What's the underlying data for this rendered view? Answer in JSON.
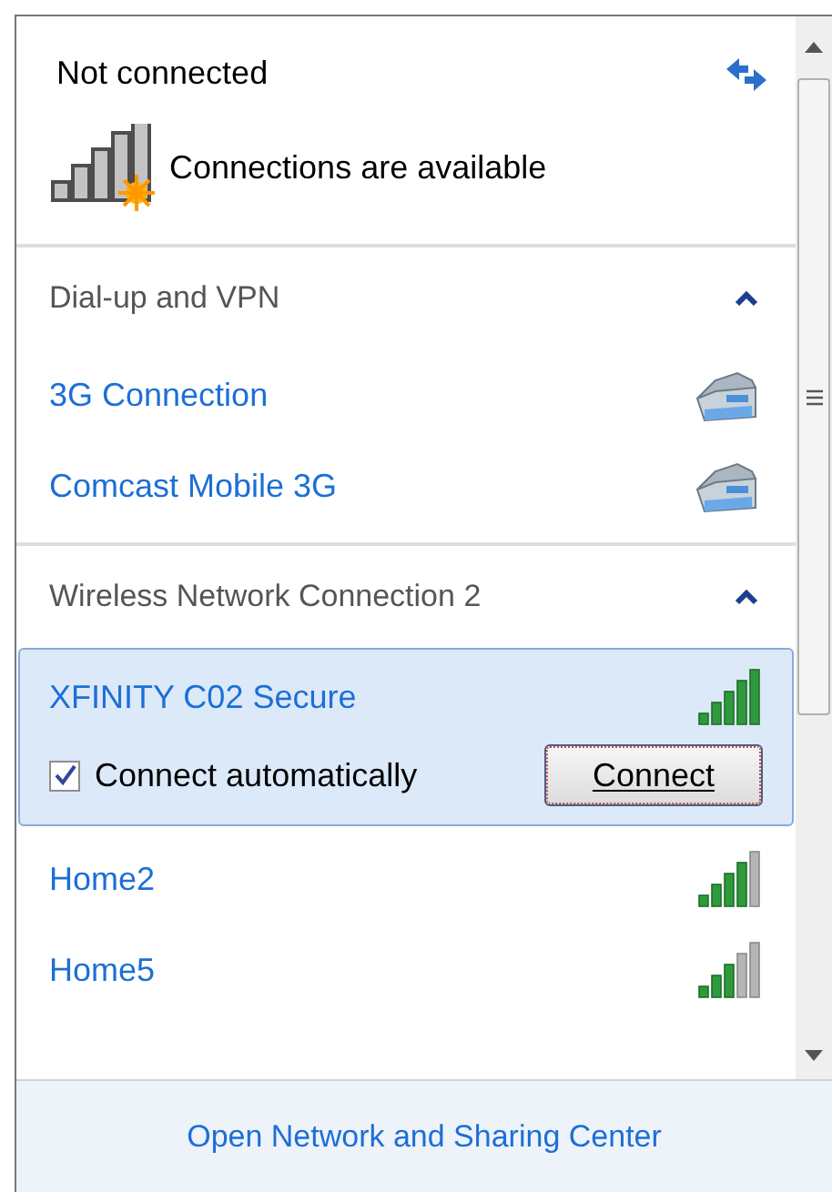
{
  "header": {
    "title": "Not connected",
    "status": "Connections are available"
  },
  "sections": [
    {
      "title": "Dial-up and VPN",
      "expanded": true,
      "items": [
        {
          "kind": "dialup",
          "name": "3G Connection",
          "selected": false
        },
        {
          "kind": "dialup",
          "name": "Comcast Mobile 3G",
          "selected": false
        }
      ]
    },
    {
      "title": "Wireless Network Connection 2",
      "expanded": true,
      "items": [
        {
          "kind": "wifi",
          "name": "XFINITY C02 Secure",
          "level": 1,
          "selected": true,
          "auto_connect": {
            "label": "Connect automatically",
            "checked": true
          },
          "button": "Connect"
        },
        {
          "kind": "wifi",
          "name": "Home2",
          "level": 0.8,
          "selected": false
        },
        {
          "kind": "wifi",
          "name": "Home5",
          "level": 0.6,
          "selected": false
        }
      ]
    }
  ],
  "footer_link": "Open Network and Sharing Center"
}
